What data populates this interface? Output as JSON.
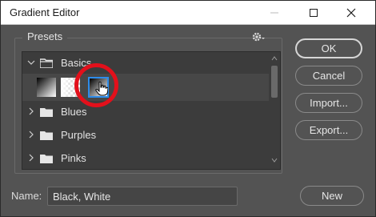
{
  "window": {
    "title": "Gradient Editor",
    "controls": {
      "minimize_icon": "minimize-icon",
      "maximize_icon": "maximize-icon",
      "close_icon": "close-icon"
    }
  },
  "presets": {
    "label": "Presets",
    "settings_icon": "gear-icon",
    "groups": [
      {
        "name": "Basics",
        "expanded": true
      },
      {
        "name": "Blues",
        "expanded": false
      },
      {
        "name": "Purples",
        "expanded": false
      },
      {
        "name": "Pinks",
        "expanded": false
      }
    ],
    "basics_swatches": [
      {
        "name": "Foreground to Background",
        "selected": false
      },
      {
        "name": "Foreground to Transparent",
        "selected": false
      },
      {
        "name": "Black, White",
        "selected": true
      }
    ],
    "selection_color": "#2d8ceb",
    "highlight_color": "#e3101b"
  },
  "buttons": {
    "ok": "OK",
    "cancel": "Cancel",
    "import": "Import...",
    "export": "Export...",
    "new": "New"
  },
  "name_field": {
    "label": "Name:",
    "value": "Black, White"
  }
}
